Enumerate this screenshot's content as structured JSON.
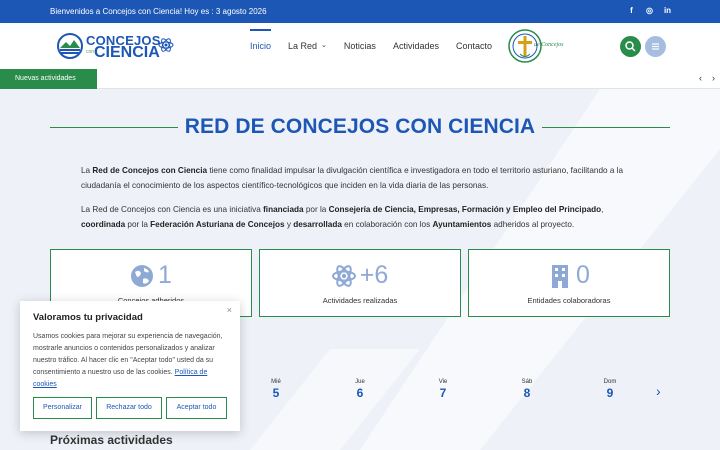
{
  "topbar": {
    "welcome": "Bienvenidos a Concejos con Ciencia! Hoy es : 3 agosto 2026",
    "social": [
      {
        "icon": "facebook-icon",
        "glyph": "f"
      },
      {
        "icon": "instagram-icon",
        "glyph": "◎"
      },
      {
        "icon": "linkedin-icon",
        "glyph": "in"
      }
    ]
  },
  "header": {
    "logo_line1": "CONCEJOS",
    "logo_con": "con",
    "logo_line2": "CIENCIA",
    "seal_text": "de Concejos",
    "nav": [
      {
        "label": "Inicio",
        "active": true
      },
      {
        "label": "La Red",
        "dropdown": true
      },
      {
        "label": "Noticias"
      },
      {
        "label": "Actividades"
      },
      {
        "label": "Contacto"
      }
    ]
  },
  "ticker": {
    "tag": "Nuevas actividades",
    "prev": "‹",
    "next": "›"
  },
  "main": {
    "title": "RED DE CONCEJOS CON CIENCIA",
    "p1": {
      "pre": "La ",
      "b1": "Red de Concejos con Ciencia",
      "post": " tiene como finalidad impulsar la divulgación científica e investigadora en todo el territorio asturiano, facilitando a la ciudadanía el conocimiento de los aspectos científico-tecnológicos que inciden en la vida diaria de las personas."
    },
    "p2": {
      "t1": "La Red de Concejos con Ciencia es una iniciativa ",
      "b1": "financiada",
      "t2": " por la ",
      "b2": "Consejería de Ciencia, Empresas, Formación y Empleo del Principado",
      "t3": ", ",
      "b3": "coordinada",
      "t4": " por la ",
      "b4": "Federación Asturiana de Concejos",
      "t5": " y ",
      "b5": "desarrollada",
      "t6": " en colaboración con los ",
      "b6": "Ayuntamientos",
      "t7": " adheridos al proyecto."
    },
    "stats": [
      {
        "icon": "globe-icon",
        "value": "1",
        "label": "Concejos adheridos"
      },
      {
        "icon": "atom-icon",
        "value": "+6",
        "label": "Actividades realizadas"
      },
      {
        "icon": "building-icon",
        "value": "0",
        "label": "Entidades colaboradoras"
      }
    ],
    "week": [
      {
        "name": "Mié",
        "date": "5"
      },
      {
        "name": "Jue",
        "date": "6"
      },
      {
        "name": "Vie",
        "date": "7"
      },
      {
        "name": "Sáb",
        "date": "8"
      },
      {
        "name": "Dom",
        "date": "9"
      }
    ],
    "week_next": "›",
    "proximas": "Próximas actividades"
  },
  "cookie": {
    "title": "Valoramos tu privacidad",
    "text": "Usamos cookies para mejorar su experiencia de navegación, mostrarle anuncios o contenidos personalizados y analizar nuestro tráfico. Al hacer clic en \"Aceptar todo\" usted da su consentimiento a nuestro uso de las cookies.",
    "link": "Política de cookies",
    "close": "×",
    "btn_customize": "Personalizar",
    "btn_reject": "Rechazar todo",
    "btn_accept": "Aceptar todo"
  },
  "colors": {
    "primary_blue": "#1d57b5",
    "green": "#2a8c4a",
    "light_blue": "#8fa9d6"
  }
}
